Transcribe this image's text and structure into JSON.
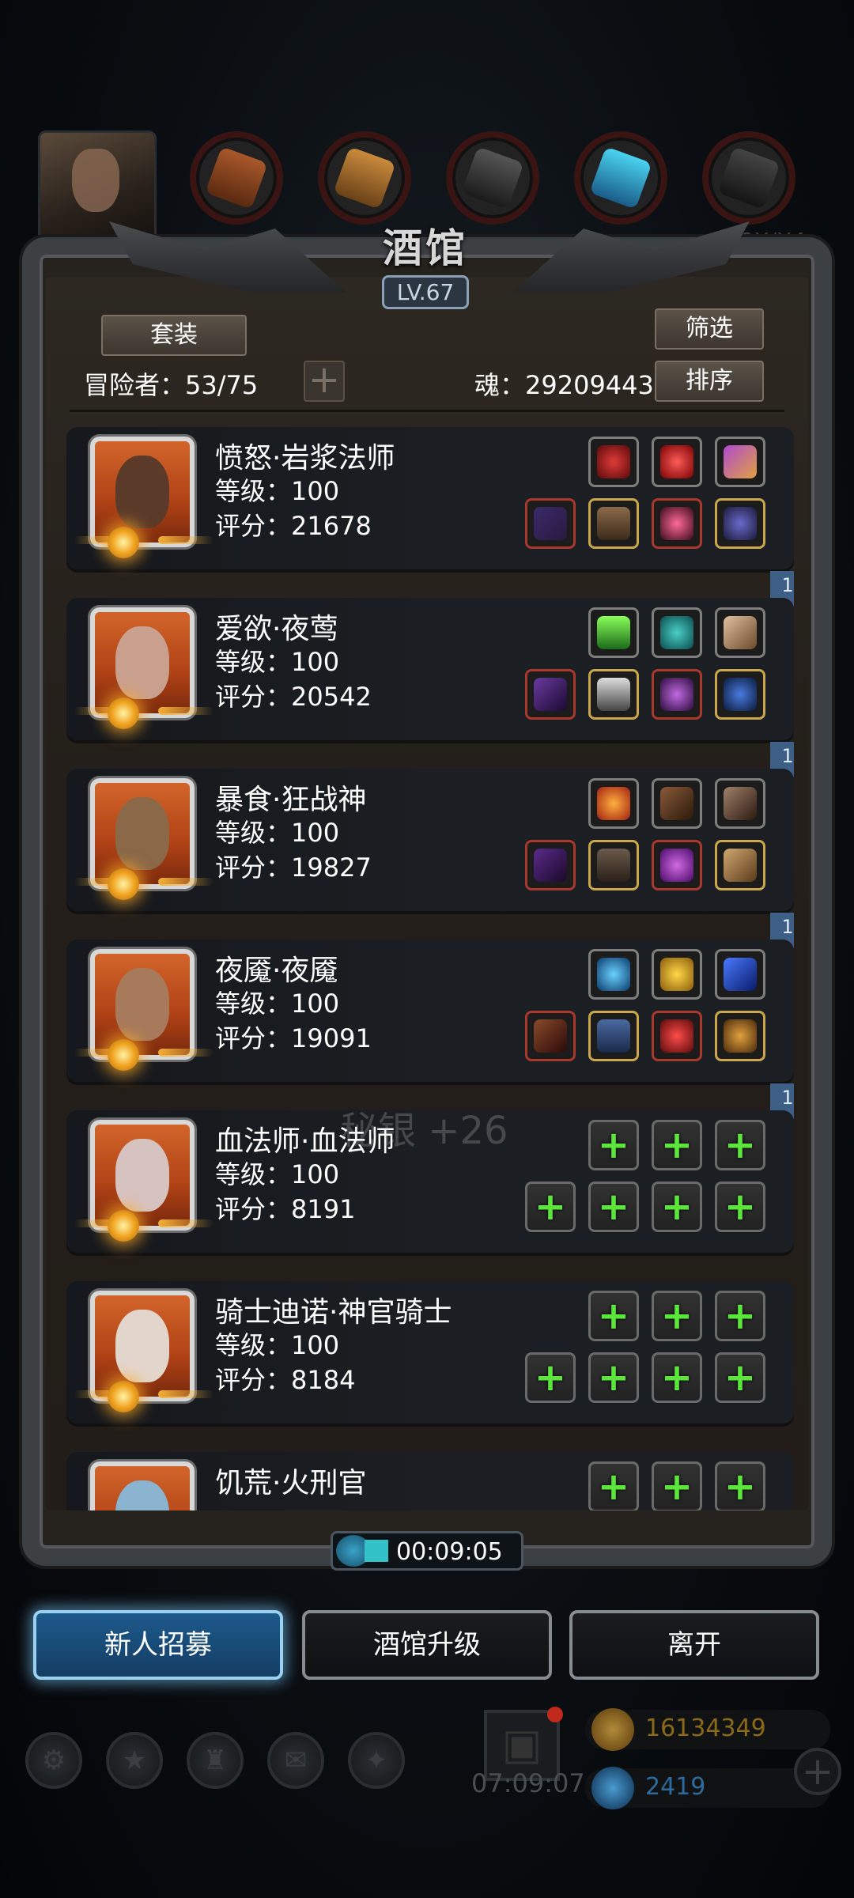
{
  "header": {
    "title": "酒馆",
    "level": "LV.67",
    "faded_right": "280X/X4"
  },
  "controls": {
    "set_button": "套装",
    "filter_button": "筛选",
    "sort_button": "排序",
    "adventurer_label": "冒险者：53/75",
    "soul_label": "魂：29209443",
    "add_button": "+"
  },
  "heroes": [
    {
      "name": "愤怒·岩浆法师",
      "level": "等级：100",
      "score": "评分：21678",
      "bookmark": "1",
      "face": "#5b3a2a"
    },
    {
      "name": "爱欲·夜莺",
      "level": "等级：100",
      "score": "评分：20542",
      "bookmark": "1",
      "face": "#c9a08e"
    },
    {
      "name": "暴食·狂战神",
      "level": "等级：100",
      "score": "评分：19827",
      "bookmark": "1",
      "face": "#8a6848"
    },
    {
      "name": "夜魇·夜魇",
      "level": "等级：100",
      "score": "评分：19091",
      "bookmark": "1",
      "face": "#a77a5c"
    },
    {
      "name": "血法师·血法师",
      "level": "等级：100",
      "score": "评分：8191",
      "bookmark": "",
      "face": "#d6c3c0"
    },
    {
      "name": "骑士迪诺·神官骑士",
      "level": "等级：100",
      "score": "评分：8184",
      "bookmark": "",
      "face": "#e2d6cc"
    },
    {
      "name": "饥荒·火刑官",
      "level": "",
      "score": "",
      "bookmark": "",
      "face": "#8ab3d0"
    }
  ],
  "ghost_text": "秘银 +26",
  "timer": "00:09:05",
  "actions": {
    "recruit": "新人招募",
    "upgrade": "酒馆升级",
    "leave": "离开"
  },
  "bottom": {
    "gift_timer": "07:09:07",
    "gold": "16134349",
    "gems": "2419",
    "add": "+"
  },
  "colors": {
    "accent_blue": "#1d5a8c",
    "plus_green": "#5ce53a",
    "gold_text": "#8a6a1a",
    "gem_text": "#2e6a9c"
  }
}
